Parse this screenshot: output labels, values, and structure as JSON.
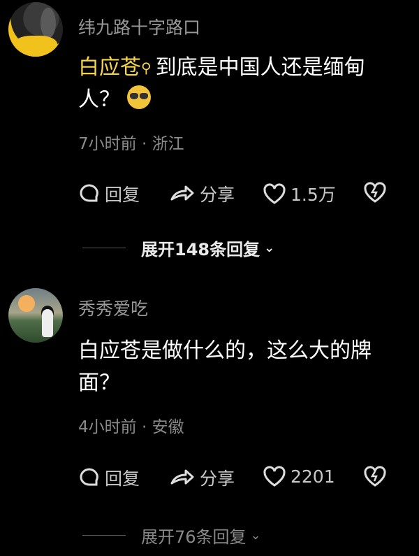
{
  "comments": [
    {
      "username": "纬九路十字路口",
      "mention": "白应苍",
      "text_line1": "到底是中国人还是缅甸",
      "text_line2": "人？",
      "time": "7小时前",
      "location": "浙江",
      "reply_label": "回复",
      "share_label": "分享",
      "likes": "1.5万",
      "expand_label": "展开148条回复"
    },
    {
      "username": "秀秀爱吃",
      "text_line1": "白应苍是做什么的，这么大的牌",
      "text_line2": "面？",
      "time": "4小时前",
      "location": "安徽",
      "reply_label": "回复",
      "share_label": "分享",
      "likes": "2201",
      "expand_label": "展开76条回复"
    }
  ],
  "separator": "·"
}
